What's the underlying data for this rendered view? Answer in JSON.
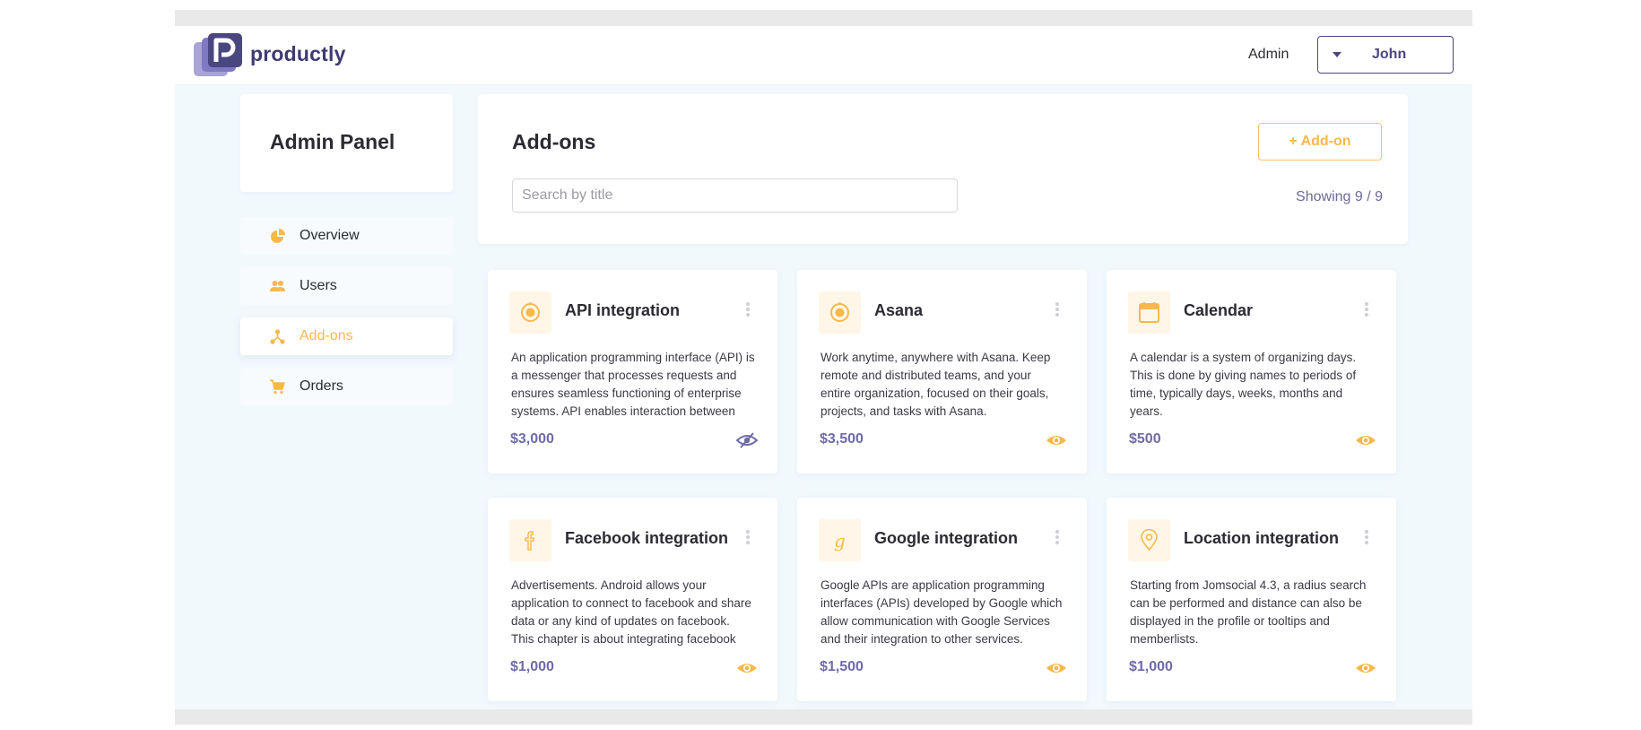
{
  "header": {
    "logo_text": "productly",
    "role": "Admin",
    "user": "John"
  },
  "sidebar": {
    "title": "Admin Panel",
    "items": [
      {
        "label": "Overview",
        "icon": "pie-chart-icon",
        "active": false
      },
      {
        "label": "Users",
        "icon": "users-icon",
        "active": false
      },
      {
        "label": "Add-ons",
        "icon": "nodes-icon",
        "active": true
      },
      {
        "label": "Orders",
        "icon": "cart-icon",
        "active": false
      }
    ]
  },
  "main": {
    "title": "Add-ons",
    "add_button": "+ Add-on",
    "search_placeholder": "Search by title",
    "showing": "Showing 9 / 9"
  },
  "colors": {
    "accent": "#f9b84a",
    "brand": "#4a4680",
    "price": "#6f6aa8",
    "background": "#f2f9fd"
  },
  "cards": [
    {
      "title": "API integration",
      "icon": "target-icon",
      "description": "An application programming interface (API) is a messenger that processes requests and ensures seamless functioning of enterprise systems. API enables interaction between",
      "price": "$3,000",
      "visibility": "hidden-eye-icon"
    },
    {
      "title": "Asana",
      "icon": "target-icon",
      "description": "Work anytime, anywhere with Asana. Keep remote and distributed teams, and your entire organization, focused on their goals, projects, and tasks with Asana.",
      "price": "$3,500",
      "visibility": "eye-icon"
    },
    {
      "title": "Calendar",
      "icon": "calendar-icon",
      "description": "A calendar is a system of organizing days. This is done by giving names to periods of time, typically days, weeks, months and years.",
      "price": "$500",
      "visibility": "eye-icon"
    },
    {
      "title": "Facebook integration",
      "icon": "facebook-icon",
      "description": "Advertisements. Android allows your application to connect to facebook and share data or any kind of updates on facebook. This chapter is about integrating facebook",
      "price": "$1,000",
      "visibility": "eye-icon"
    },
    {
      "title": "Google integration",
      "icon": "google-icon",
      "description": "Google APIs are application programming interfaces (APIs) developed by Google which allow communication with Google Services and their integration to other services.",
      "price": "$1,500",
      "visibility": "eye-icon"
    },
    {
      "title": "Location integration",
      "icon": "location-pin-icon",
      "description": "Starting from Jomsocial 4.3, a radius search can be performed and distance can also be displayed in the profile or tooltips and memberlists.",
      "price": "$1,000",
      "visibility": "eye-icon"
    }
  ]
}
